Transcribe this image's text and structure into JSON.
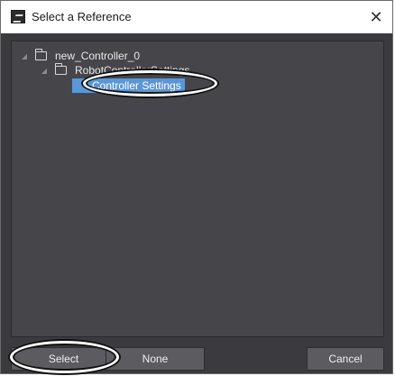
{
  "window": {
    "title": "Select a Reference",
    "close_icon": "close-icon",
    "app_icon": "app-icon"
  },
  "tree": {
    "items": [
      {
        "label": "new_Controller_0",
        "level": 0,
        "expanded": true
      },
      {
        "label": "RobotControllerSettings",
        "level": 1,
        "expanded": true
      },
      {
        "label": "Controller Settings",
        "level": 2,
        "selected": true
      }
    ]
  },
  "footer": {
    "select_label": "Select",
    "none_label": "None",
    "cancel_label": "Cancel"
  },
  "colors": {
    "panel_bg": "#46464a",
    "selection": "#5a97d8",
    "button_bg": "#5b5b60"
  }
}
